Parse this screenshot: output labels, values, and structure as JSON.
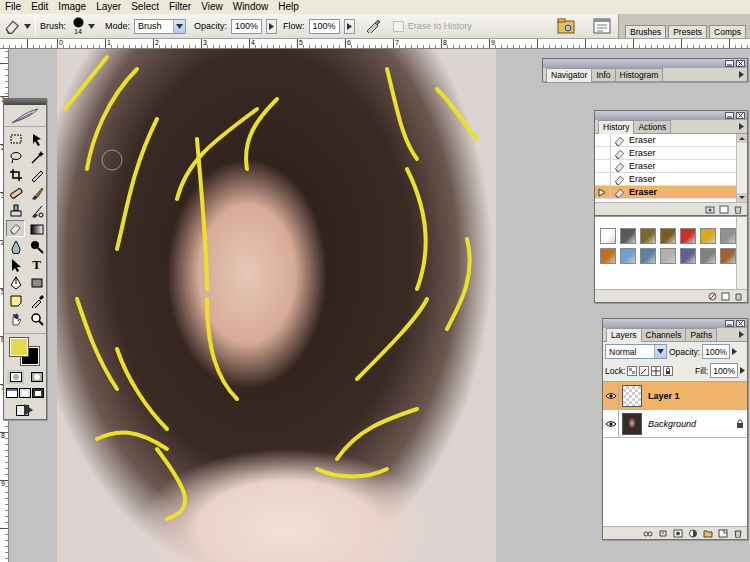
{
  "menu": [
    "File",
    "Edit",
    "Image",
    "Layer",
    "Select",
    "Filter",
    "View",
    "Window",
    "Help"
  ],
  "options": {
    "brush_label": "Brush:",
    "brush_size": "14",
    "mode_label": "Mode:",
    "mode": "Brush",
    "opacity_label": "Opacity:",
    "opacity": "100%",
    "flow_label": "Flow:",
    "flow": "100%",
    "airbrush_on": false,
    "erase_to_history": {
      "label": "Erase to History",
      "checked": false,
      "disabled": true
    }
  },
  "palette_well": [
    "Brushes",
    "Presets",
    "Comps"
  ],
  "rulers": {
    "top": [
      "0",
      "1",
      "2",
      "3",
      "4",
      "5",
      "6",
      "7",
      "8",
      "9"
    ],
    "left": [
      "1",
      "2",
      "3",
      "4",
      "5",
      "6",
      "7",
      "8",
      "9"
    ]
  },
  "toolbox": {
    "tools": [
      {
        "selected": false
      },
      {
        "selected": false
      },
      {
        "selected": false
      },
      {
        "selected": false
      },
      {
        "selected": false
      },
      {
        "selected": false
      },
      {
        "selected": false
      },
      {
        "selected": false
      },
      {
        "selected": false
      },
      {
        "selected": false
      },
      {
        "selected": true
      },
      {
        "selected": false
      },
      {
        "selected": false
      },
      {
        "selected": false
      },
      {
        "selected": false
      },
      {
        "selected": false,
        "glyph": "T"
      },
      {
        "selected": false
      },
      {
        "selected": false
      },
      {
        "selected": false
      },
      {
        "selected": false
      },
      {
        "selected": false
      },
      {
        "selected": false
      }
    ],
    "foreground": "#e6d84c",
    "background": "#000000",
    "quick_mask": false
  },
  "navigator": {
    "tabs": [
      {
        "label": "Navigator",
        "selected": true
      },
      {
        "label": "Info",
        "selected": false
      },
      {
        "label": "Histogram",
        "selected": false
      }
    ]
  },
  "history": {
    "tabs": [
      {
        "label": "History",
        "selected": true
      },
      {
        "label": "Actions",
        "selected": false
      }
    ],
    "states": [
      {
        "label": "Eraser",
        "selected": false
      },
      {
        "label": "Eraser",
        "selected": false
      },
      {
        "label": "Eraser",
        "selected": false
      },
      {
        "label": "Eraser",
        "selected": false
      },
      {
        "label": "Eraser",
        "selected": true
      }
    ]
  },
  "styles": {
    "swatches": [
      {
        "color": "#ffffff"
      },
      {
        "color": "#5a5a5a"
      },
      {
        "color": "#7a6a2a"
      },
      {
        "color": "#7a5a20"
      },
      {
        "color": "#c83030"
      },
      {
        "color": "#d8a820"
      },
      {
        "color": "#909090"
      },
      {
        "color": "#c07020"
      },
      {
        "color": "#70a0d0"
      },
      {
        "color": "#6080a0"
      },
      {
        "color": "#b0b0b0"
      },
      {
        "color": "#606090"
      },
      {
        "color": "#808080"
      },
      {
        "color": "#a06030"
      }
    ]
  },
  "layers": {
    "tabs": [
      {
        "label": "Layers",
        "selected": true
      },
      {
        "label": "Channels",
        "selected": false
      },
      {
        "label": "Paths",
        "selected": false
      }
    ],
    "blend_mode": "Normal",
    "opacity_label": "Opacity:",
    "opacity": "100%",
    "lock_label": "Lock:",
    "fill_label": "Fill:",
    "fill": "100%",
    "items": [
      {
        "name": "Layer 1",
        "selected": true,
        "visible": true,
        "locked": false,
        "kind": "transparent"
      },
      {
        "name": "Background",
        "selected": false,
        "visible": true,
        "locked": true,
        "kind": "photo"
      }
    ]
  }
}
